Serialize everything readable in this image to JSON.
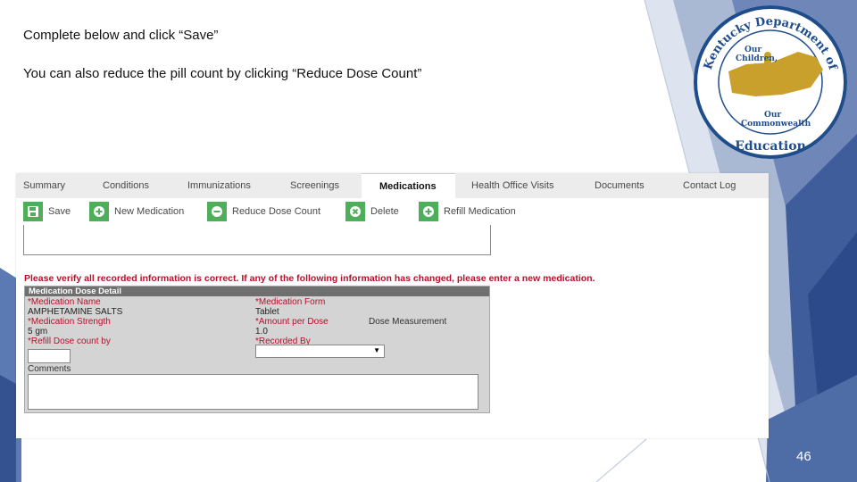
{
  "slide": {
    "instruction_1": "Complete below and click “Save”",
    "instruction_2": "You can also reduce the pill count by clicking “Reduce Dose Count”",
    "page_number": "46"
  },
  "logo": {
    "arc_top": "Kentucky Department of",
    "line1": "Our",
    "line2": "Children,",
    "line3": "Our",
    "line4": "Commonwealth",
    "bottom": "Education"
  },
  "tabs": [
    {
      "label": "Summary"
    },
    {
      "label": "Conditions"
    },
    {
      "label": "Immunizations"
    },
    {
      "label": "Screenings"
    },
    {
      "label": "Medications"
    },
    {
      "label": "Health Office Visits"
    },
    {
      "label": "Documents"
    },
    {
      "label": "Contact Log"
    }
  ],
  "toolbar": {
    "save": "Save",
    "new_medication": "New Medication",
    "reduce_dose_count": "Reduce Dose Count",
    "delete": "Delete",
    "refill_medication": "Refill Medication"
  },
  "warning": "Please verify all recorded information is correct. If any of the following information has changed, please enter a new medication.",
  "form": {
    "header": "Medication Dose Detail",
    "medication_name_label": "*Medication Name",
    "medication_name_value": "AMPHETAMINE SALTS",
    "medication_strength_label": "*Medication Strength",
    "medication_strength_value": "5 gm",
    "refill_label": "*Refill Dose count by",
    "comments_label": "Comments",
    "medication_form_label": "*Medication Form",
    "medication_form_value": "Tablet",
    "amount_per_dose_label": "*Amount per Dose",
    "amount_per_dose_value": "1.0",
    "dose_measurement_label": "Dose Measurement",
    "recorded_by_label": "*Recorded By"
  },
  "colors": {
    "accent_blue": "#3a5a96",
    "button_green": "#4fae59",
    "warning_red": "#b3122a",
    "logo_gold": "#c9a02c"
  }
}
